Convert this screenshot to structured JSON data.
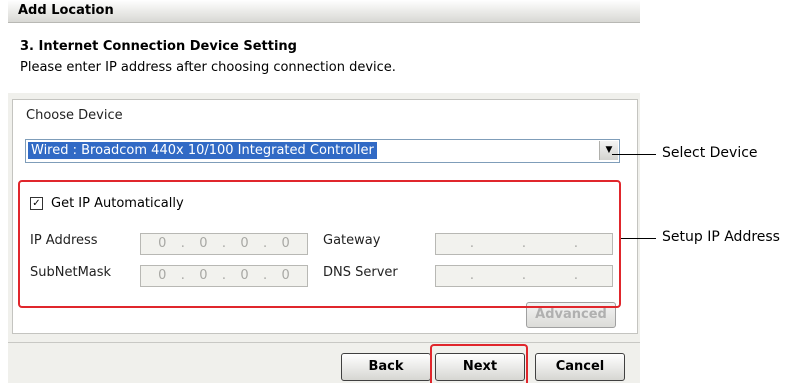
{
  "dialog": {
    "title": "Add Location",
    "step_title": "3. Internet Connection Device Setting",
    "step_desc": "Please enter IP address after choosing connection device."
  },
  "device": {
    "label": "Choose Device",
    "selected": "Wired : Broadcom 440x 10/100 Integrated Controller"
  },
  "ip": {
    "auto_label": "Get IP Automatically",
    "auto_checked": true,
    "ip_address_label": "IP Address",
    "ip_address_value": [
      "0",
      ".",
      "0",
      ".",
      "0",
      ".",
      "0"
    ],
    "subnet_label": "SubNetMask",
    "subnet_value": [
      "0",
      ".",
      "0",
      ".",
      "0",
      ".",
      "0"
    ],
    "gateway_label": "Gateway",
    "dns_label": "DNS Server",
    "advanced_label": "Advanced"
  },
  "buttons": {
    "back": "Back",
    "next": "Next",
    "cancel": "Cancel"
  },
  "callouts": {
    "select_device": "Select Device",
    "setup_ip": "Setup IP Address"
  },
  "colors": {
    "highlight": "#e0262c",
    "selection": "#316ac5"
  }
}
